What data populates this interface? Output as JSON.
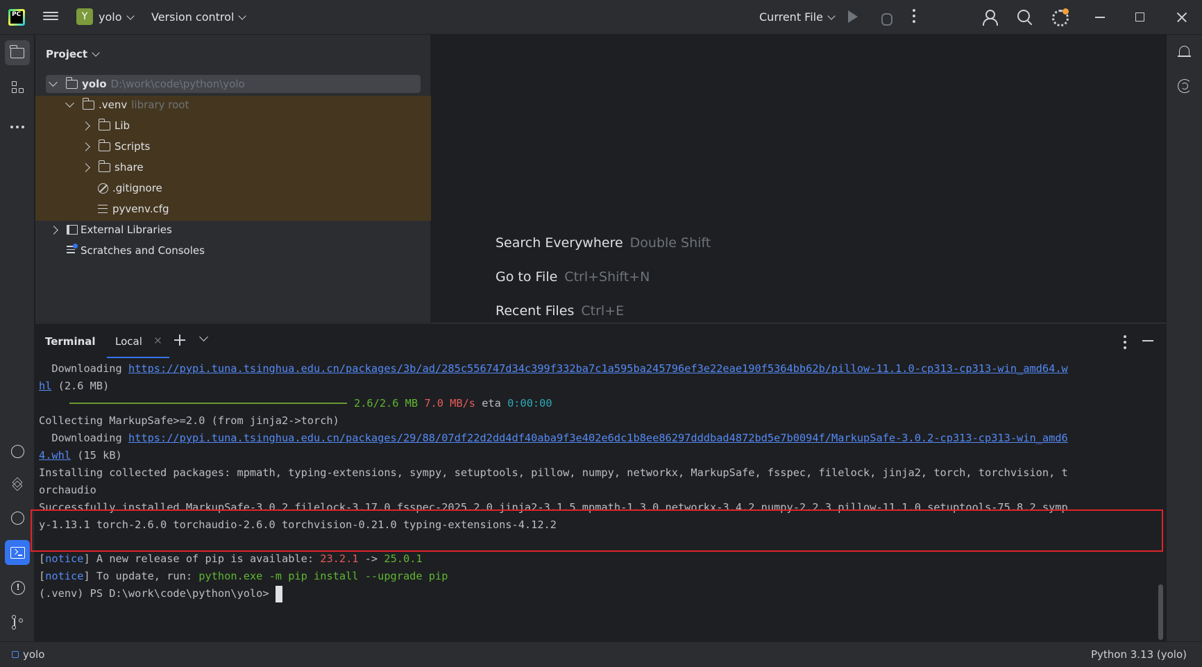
{
  "titlebar": {
    "project_initial": "Y",
    "project_name": "yolo",
    "version_control": "Version control",
    "run_config": "Current File"
  },
  "project_panel": {
    "header": "Project",
    "tree": {
      "root_name": "yolo",
      "root_path": "D:\\work\\code\\python\\yolo",
      "venv_name": ".venv",
      "venv_hint": "library root",
      "lib": "Lib",
      "scripts": "Scripts",
      "share": "share",
      "gitignore": ".gitignore",
      "pyvenv": "pyvenv.cfg",
      "external_libraries": "External Libraries",
      "scratches": "Scratches and Consoles"
    }
  },
  "editor_hints": [
    {
      "label": "Search Everywhere",
      "shortcut": "Double Shift"
    },
    {
      "label": "Go to File",
      "shortcut": "Ctrl+Shift+N"
    },
    {
      "label": "Recent Files",
      "shortcut": "Ctrl+E"
    }
  ],
  "terminal": {
    "title": "Terminal",
    "tab_label": "Local",
    "lines": {
      "l1_prefix": "  Downloading ",
      "l1_link": "https://pypi.tuna.tsinghua.edu.cn/packages/3b/ad/285c556747d34c399f332ba7c1a595ba245796ef3e22eae190f5364bb62b/pillow-11.1.0-cp313-cp313-win_amd64.w",
      "l2_link": "hl",
      "l2_suffix": " (2.6 MB)",
      "progress_size": "2.6/2.6 MB",
      "progress_speed": "7.0 MB/s",
      "progress_eta_label": " eta ",
      "progress_eta": "0:00:00",
      "progress_fraction": 1.0,
      "l4": "Collecting MarkupSafe>=2.0 (from jinja2->torch)",
      "l5_prefix": "  Downloading ",
      "l5_link": "https://pypi.tuna.tsinghua.edu.cn/packages/29/88/07df22d2dd4df40aba9f3e402e6dc1b8ee86297dddbad4872bd5e7b0094f/MarkupSafe-3.0.2-cp313-cp313-win_amd6",
      "l6_link": "4.whl",
      "l6_suffix": " (15 kB)",
      "l7": "Installing collected packages: mpmath, typing-extensions, sympy, setuptools, pillow, numpy, networkx, MarkupSafe, fsspec, filelock, jinja2, torch, torchvision, t",
      "l8": "orchaudio",
      "l9": "Successfully installed MarkupSafe-3.0.2 filelock-3.17.0 fsspec-2025.2.0 jinja2-3.1.5 mpmath-1.3.0 networkx-3.4.2 numpy-2.2.3 pillow-11.1.0 setuptools-75.8.2 symp",
      "l10": "y-1.13.1 torch-2.6.0 torchaudio-2.6.0 torchvision-0.21.0 typing-extensions-4.12.2",
      "notice_word": "notice",
      "n1_text": " A new release of pip is available: ",
      "n1_old": "23.2.1",
      "n1_arrow": " -> ",
      "n1_new": "25.0.1",
      "n2_text": " To update, run: ",
      "n2_cmd": "python.exe -m pip install --upgrade pip",
      "prompt": "(.venv) PS D:\\work\\code\\python\\yolo> "
    }
  },
  "statusbar": {
    "project": "yolo",
    "interpreter": "Python 3.13 (yolo)"
  },
  "colors": {
    "accent": "#3574f0",
    "highlight_box": "#e0242a",
    "library_root_bg": "#45371f"
  }
}
